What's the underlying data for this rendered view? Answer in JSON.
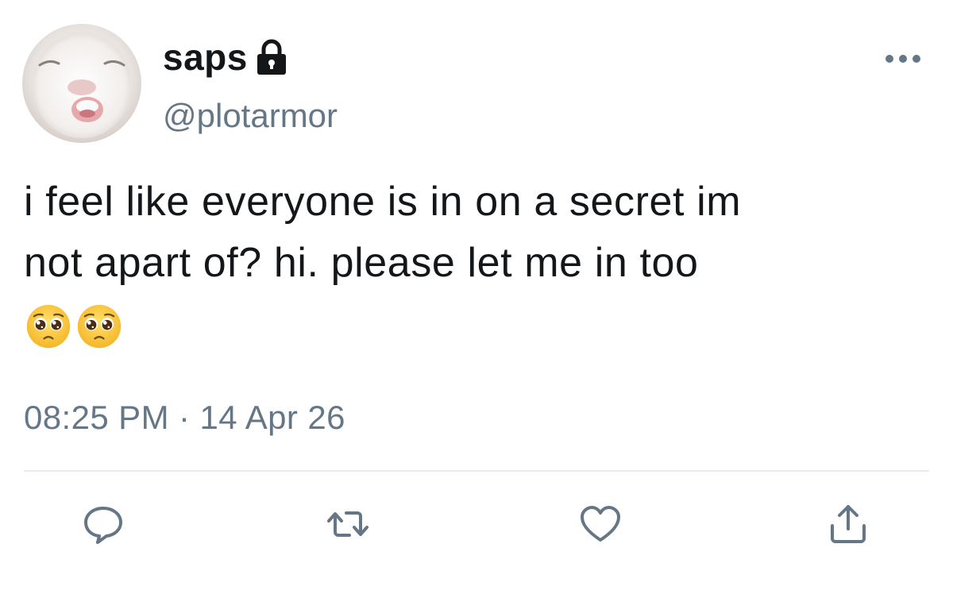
{
  "user": {
    "display_name": "saps",
    "handle": "@plotarmor",
    "protected_icon": "lock-icon",
    "avatar": "avatar-image"
  },
  "tweet": {
    "text": "i feel like everyone is in on a secret im\nnot apart of? hi. please let me in too",
    "emojis": [
      "pleading-face-emoji",
      "pleading-face-emoji"
    ],
    "timestamp": "08:25 PM · 14 Apr 26"
  },
  "actions": {
    "more": "more-options-icon",
    "reply": "reply-icon",
    "retweet": "retweet-icon",
    "like": "heart-icon",
    "share": "share-icon"
  },
  "colors": {
    "text_primary": "#14171a",
    "text_secondary": "#657786",
    "icon": "#657786",
    "divider": "#e6ecf0"
  }
}
